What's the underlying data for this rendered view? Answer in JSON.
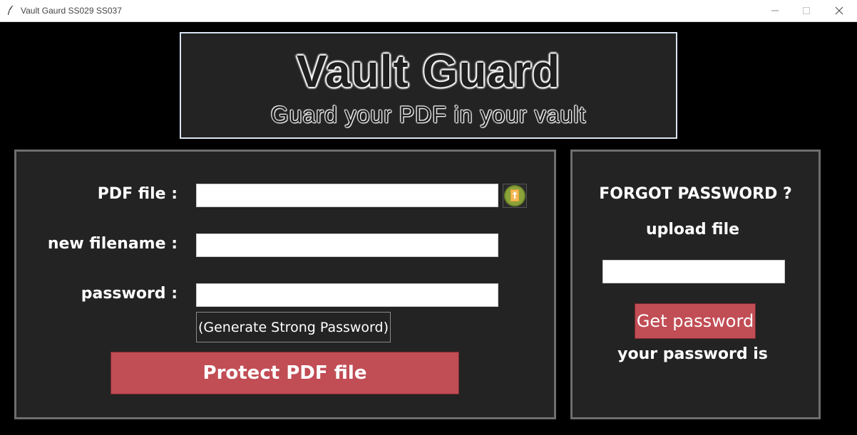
{
  "window": {
    "title": "Vault Gaurd SS029 SS037",
    "minimize_icon": "minimize-icon",
    "maximize_icon": "maximize-icon",
    "close_icon": "close-icon"
  },
  "banner": {
    "title": "Vault Guard",
    "subtitle": "Guard your PDF in your vault"
  },
  "protect_panel": {
    "pdf_label": "PDF file :",
    "pdf_value": "",
    "upload_icon": "upload-file-icon",
    "filename_label": "new filename :",
    "filename_value": "",
    "password_label": "password :",
    "password_value": "",
    "generate_label": "(Generate Strong Password)",
    "protect_label": "Protect PDF file"
  },
  "forgot_panel": {
    "heading": "FORGOT PASSWORD ?",
    "upload_label": "upload file",
    "file_value": "",
    "get_password_label": "Get password",
    "result_label": "your password is"
  },
  "colors": {
    "background": "#000000",
    "panel": "#232323",
    "accent_button": "#c14d55",
    "upload_icon_bg": "#6f8a2a",
    "upload_icon_fg": "#e8a23a"
  }
}
